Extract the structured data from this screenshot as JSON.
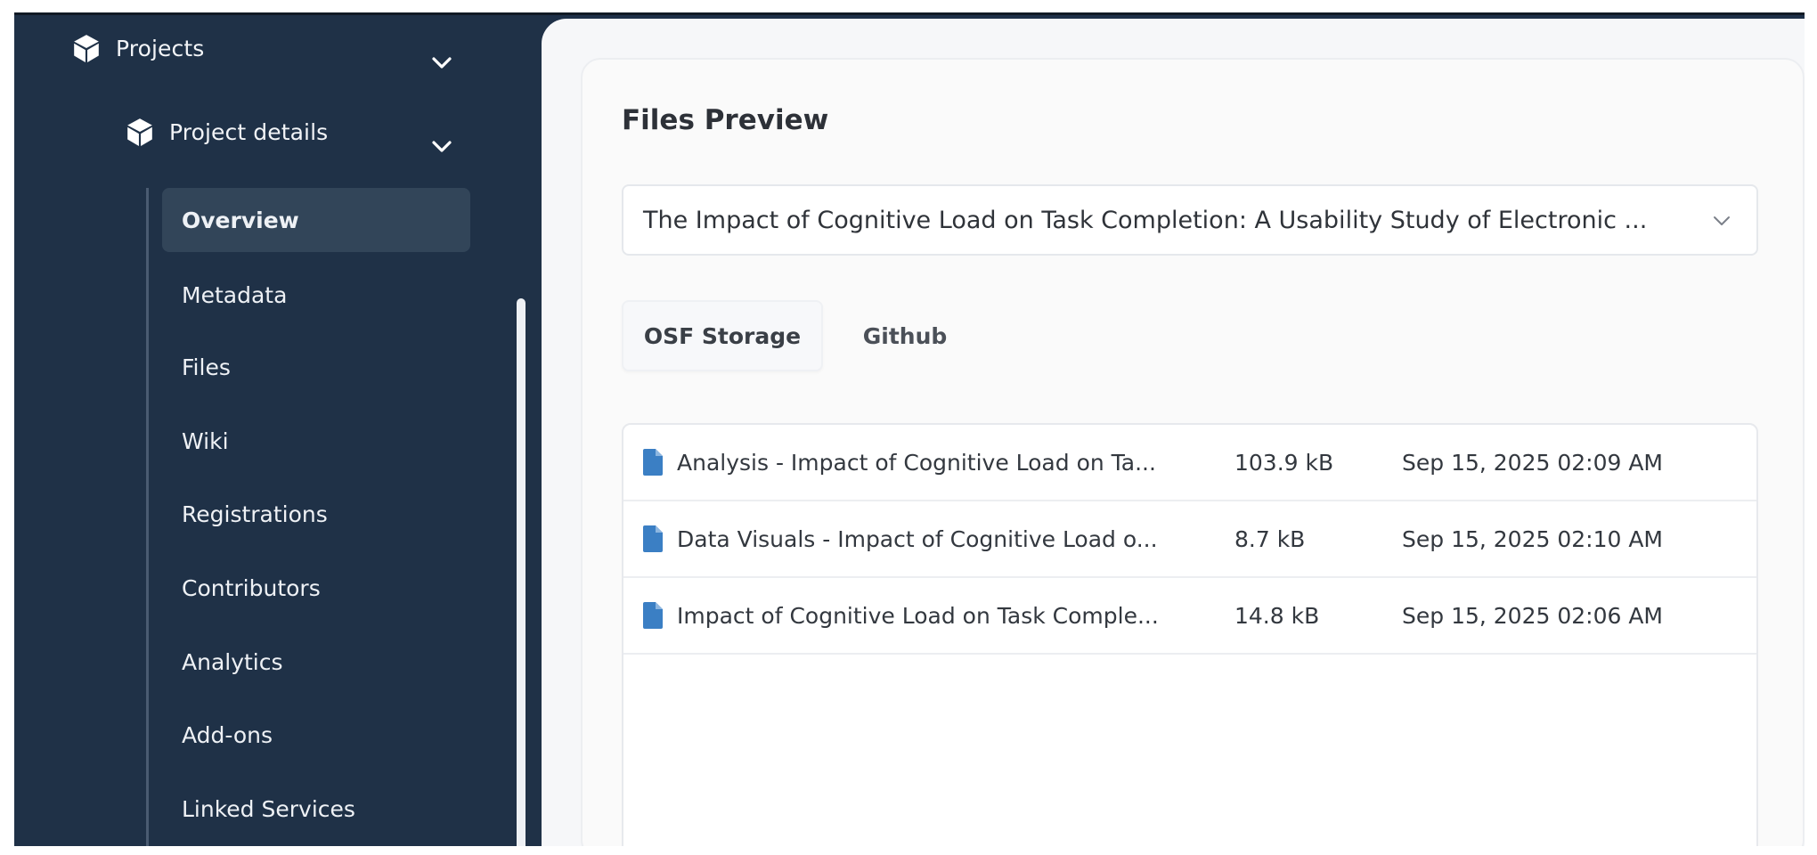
{
  "sidebar": {
    "projects_label": "Projects",
    "project_details_label": "Project details",
    "items": [
      {
        "label": "Overview"
      },
      {
        "label": "Metadata"
      },
      {
        "label": "Files"
      },
      {
        "label": "Wiki"
      },
      {
        "label": "Registrations"
      },
      {
        "label": "Contributors"
      },
      {
        "label": "Analytics"
      },
      {
        "label": "Add-ons"
      },
      {
        "label": "Linked Services"
      }
    ]
  },
  "main": {
    "title": "Files Preview",
    "project_select_value": "The Impact of Cognitive Load on Task Completion: A Usability Study of Electronic ...",
    "tabs": [
      {
        "label": "OSF Storage"
      },
      {
        "label": "Github"
      }
    ],
    "files": [
      {
        "name": "Analysis - Impact of Cognitive Load on Ta...",
        "size": "103.9 kB",
        "date": "Sep 15, 2025 02:09 AM"
      },
      {
        "name": "Data Visuals - Impact of Cognitive Load o...",
        "size": "8.7 kB",
        "date": "Sep 15, 2025 02:10 AM"
      },
      {
        "name": "Impact of Cognitive Load on Task Comple...",
        "size": "14.8 kB",
        "date": "Sep 15, 2025 02:06 AM"
      }
    ]
  },
  "colors": {
    "sidebar_bg": "#1f3147",
    "active_item_bg": "#324559",
    "file_icon": "#3b7fc4",
    "content_bg": "#f6f7f9"
  },
  "icons": {
    "projects": "cube-icon",
    "project_details": "cube-icon",
    "expand": "chevron-down-icon",
    "file": "file-icon"
  }
}
